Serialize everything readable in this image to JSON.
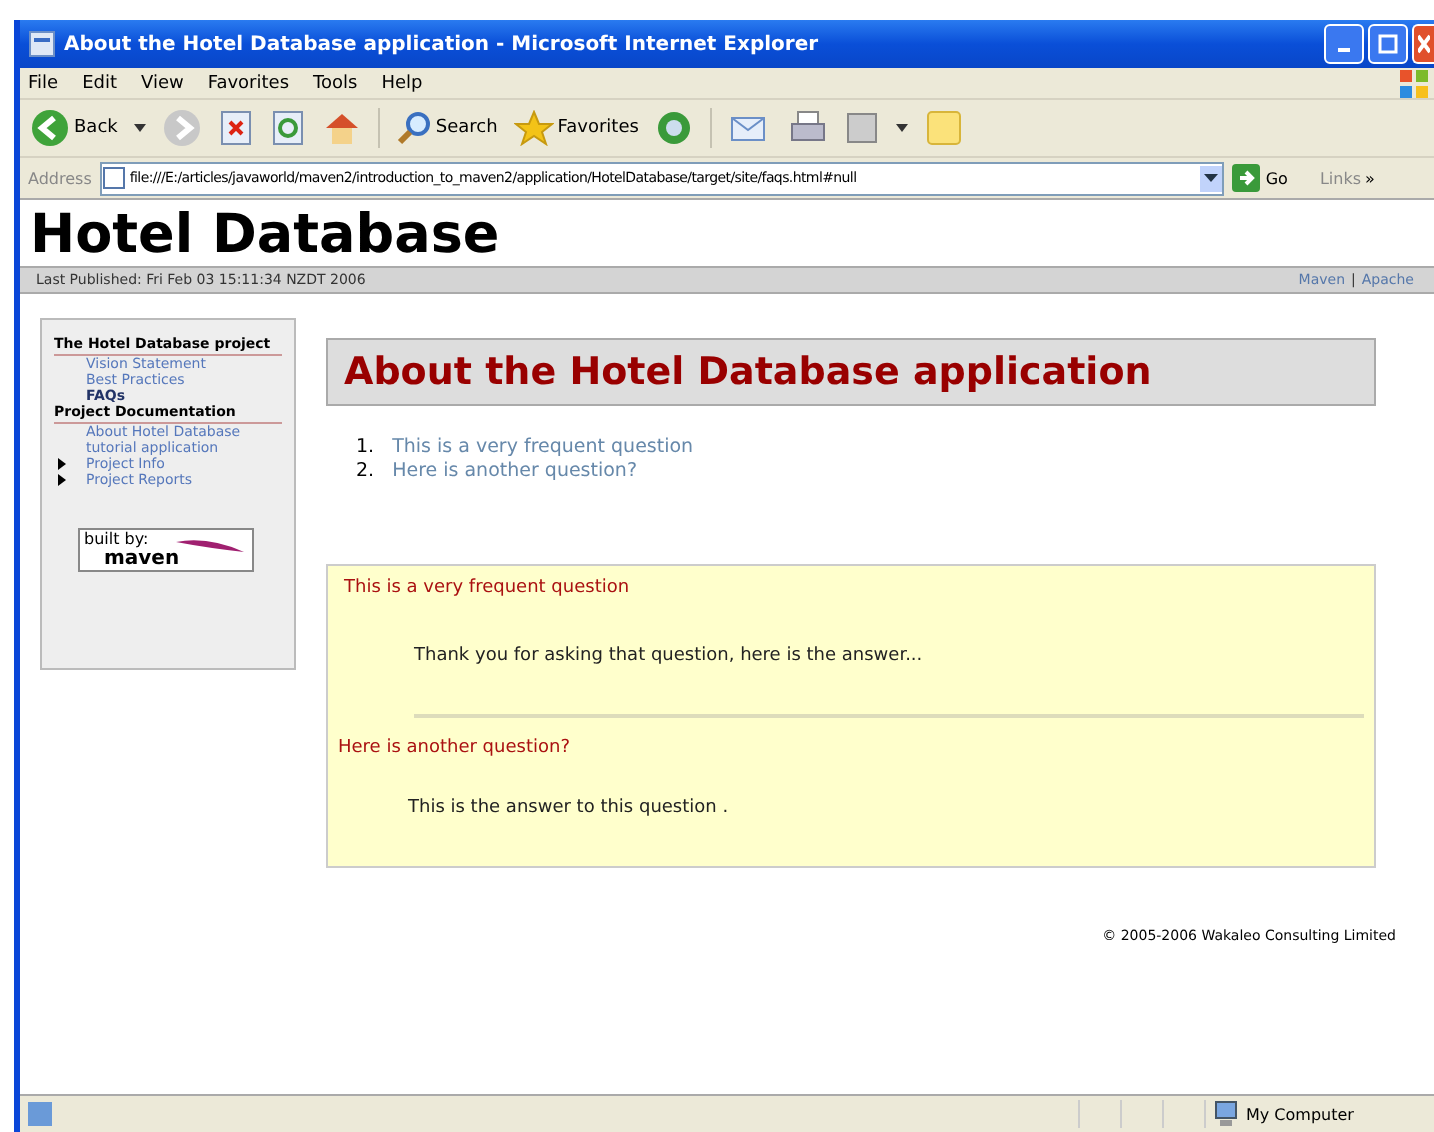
{
  "window": {
    "title": "About the Hotel Database application - Microsoft Internet Explorer"
  },
  "menu": [
    "File",
    "Edit",
    "View",
    "Favorites",
    "Tools",
    "Help"
  ],
  "toolbar": {
    "back": "Back",
    "search": "Search",
    "favorites": "Favorites"
  },
  "address_bar": {
    "label": "Address",
    "url": "file:///E:/articles/javaworld/maven2/introduction_to_maven2/application/HotelDatabase/target/site/faqs.html#null",
    "go": "Go",
    "links": "Links",
    "more": "»"
  },
  "page": {
    "site_title": "Hotel Database",
    "published": "Last Published: Fri Feb 03 15:11:34 NZDT 2006",
    "top_links": [
      "Maven",
      "Apache"
    ],
    "top_link_separator": "|",
    "sidebar": [
      {
        "heading": "The Hotel Database project",
        "items": [
          {
            "label": "Vision Statement",
            "selected": false,
            "expandable": false
          },
          {
            "label": "Best Practices",
            "selected": false,
            "expandable": false
          },
          {
            "label": "FAQs",
            "selected": true,
            "expandable": false
          }
        ]
      },
      {
        "heading": "Project Documentation",
        "items": [
          {
            "label": "About Hotel Database tutorial application",
            "selected": false,
            "expandable": false
          },
          {
            "label": "Project Info",
            "selected": false,
            "expandable": true
          },
          {
            "label": "Project Reports",
            "selected": false,
            "expandable": true
          }
        ]
      }
    ],
    "badge": {
      "line1": "built by:",
      "line2": "maven"
    },
    "heading": "About the Hotel Database application",
    "toc": [
      {
        "number": "1.",
        "label": "This is a very frequent question"
      },
      {
        "number": "2.",
        "label": "Here is another question?"
      }
    ],
    "faqs": [
      {
        "question": "This is a very frequent question",
        "answer": "Thank you for asking that question, here is the answer..."
      },
      {
        "question": "Here is another question?",
        "answer": "This is the answer to this question ."
      }
    ],
    "footer": "© 2005-2006 Wakaleo Consulting Limited"
  },
  "status_bar": {
    "zone": "My Computer"
  }
}
